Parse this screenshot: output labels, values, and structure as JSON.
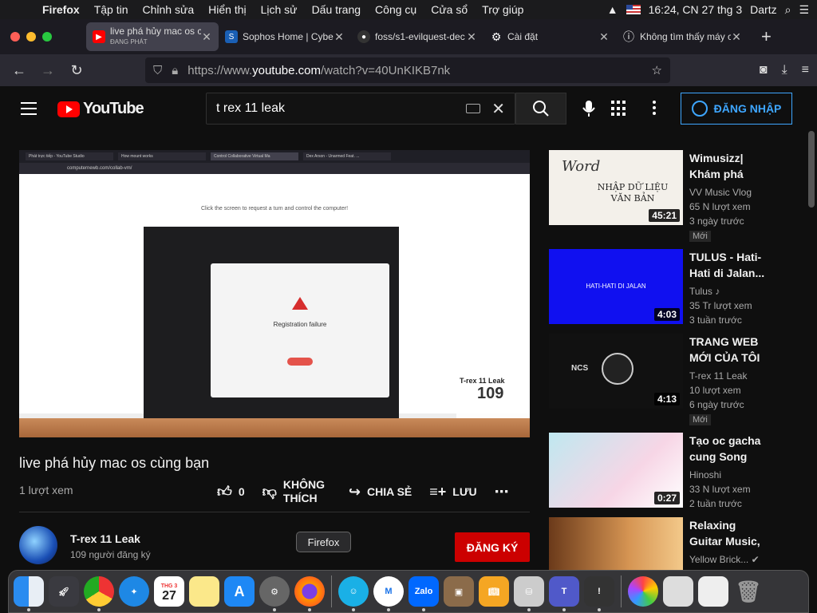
{
  "menubar": {
    "items": [
      "Firefox",
      "Tập tin",
      "Chỉnh sửa",
      "Hiển thị",
      "Lịch sử",
      "Dấu trang",
      "Công cụ",
      "Cửa sổ",
      "Trợ giúp"
    ],
    "clock": "16:24, CN 27 thg 3",
    "user": "Dartz"
  },
  "tabs": [
    {
      "title": "live phá hủy mac os c",
      "subtitle": "ĐANG PHÁT",
      "icon": "youtube-icon",
      "color": "#ff0000"
    },
    {
      "title": "Sophos Home | Cybe",
      "icon": "sophos-icon",
      "color": "#1a5fb4"
    },
    {
      "title": "foss/s1-evilquest-dec",
      "icon": "github-icon",
      "color": "#333333"
    },
    {
      "title": "Cài đặt",
      "icon": "gear-icon",
      "color": "#42414d"
    },
    {
      "title": "Không tìm thấy máy c",
      "icon": "info-icon",
      "color": "#42414d"
    }
  ],
  "url": {
    "prefix": "https://www.",
    "domain": "youtube.com",
    "path": "/watch?v=40UnKIKB7nk"
  },
  "youtube": {
    "logo": "YouTube",
    "search_value": "t rex 11 leak",
    "signin": "ĐĂNG NHẬP"
  },
  "video_frame": {
    "tabs": [
      "Phát trực tiếp - YouTube Studio",
      "How mount works",
      "Control Collaborative Virtual Ma",
      "Dex Arson - Unarmed Feat. ..."
    ],
    "url": "computernewb.com/collab-vm/",
    "caption": "Click the screen to request a turn and control the computer!",
    "dialog_title": "Registration failure",
    "overlay_name": "T-rex 11 Leak",
    "overlay_count": "109"
  },
  "video": {
    "title": "live phá hủy mac os cùng bạn",
    "views": "1 lượt xem",
    "likes": "0",
    "dislike_label": "KHÔNG THÍCH",
    "share_label": "CHIA SẺ",
    "save_label": "LƯU"
  },
  "channel": {
    "name": "T-rex 11 Leak",
    "subscribers": "109 người đăng ký",
    "subscribe_label": "ĐĂNG KÝ"
  },
  "related": [
    {
      "title": "Wimusizz| Khám phá Wo...",
      "channel": "VV Music Vlog",
      "views": "65 N lượt xem",
      "age": "3 ngày trước",
      "badge": "Mới",
      "duration": "45:21",
      "thumb_text": "NHẬP DỮ LIỆU VĂN BẢN"
    },
    {
      "title": "TULUS - Hati-Hati di Jalan...",
      "channel": "Tulus ♪",
      "views": "35 Tr lượt xem",
      "age": "3 tuần trước",
      "badge": "",
      "duration": "4:03",
      "thumb_text": "HATI-HATI DI JALAN"
    },
    {
      "title": "TRANG WEB MỚI CỦA TÔI",
      "channel": "T-rex 11 Leak",
      "views": "10 lượt xem",
      "age": "6 ngày trước",
      "badge": "Mới",
      "duration": "4:13",
      "thumb_text": "NCS"
    },
    {
      "title": "Tạo oc gacha cung Song Ng...",
      "channel": "Hinoshi",
      "views": "33 N lượt xem",
      "age": "2 tuần trước",
      "badge": "",
      "duration": "0:27",
      "thumb_text": ""
    },
    {
      "title": "Relaxing Guitar Music, Calm...",
      "channel": "Yellow Brick... ✔",
      "views": "",
      "age": "",
      "badge": "",
      "duration": "",
      "thumb_text": ""
    }
  ],
  "tooltip": "Firefox",
  "dock": {
    "calendar_month": "THG 3",
    "calendar_day": "27"
  }
}
